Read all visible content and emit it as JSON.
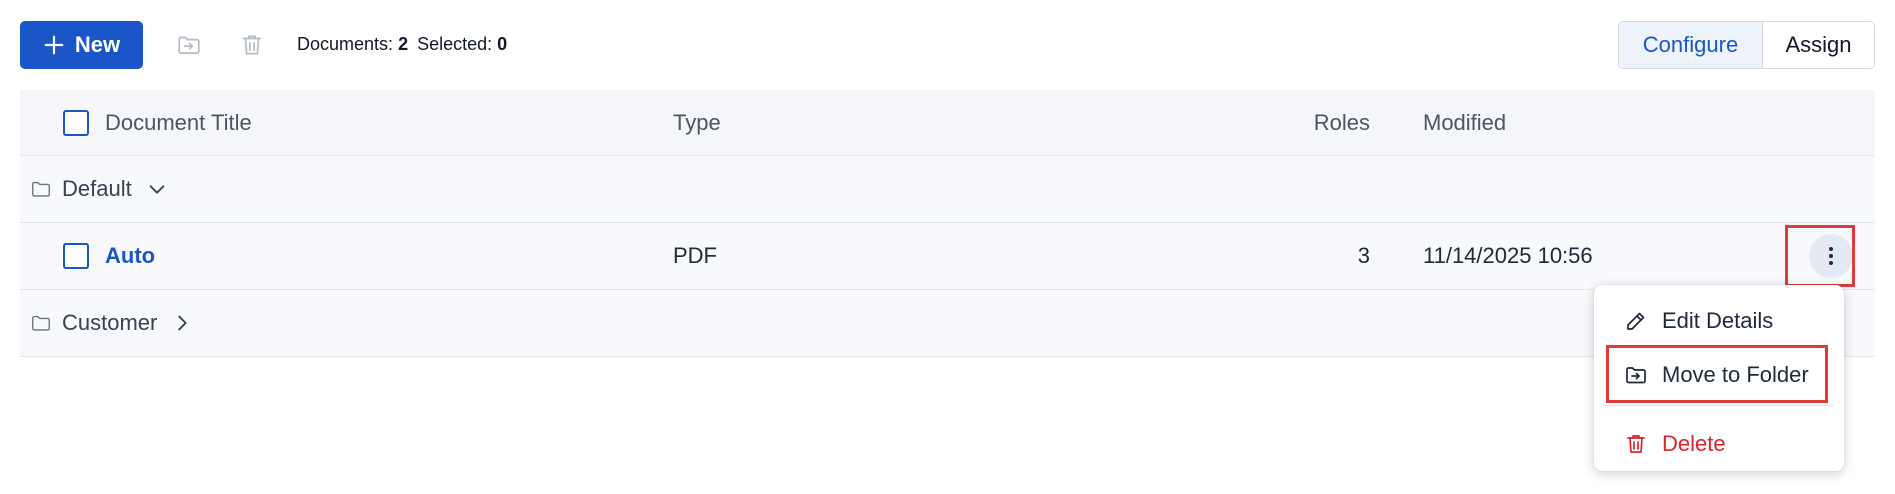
{
  "toolbar": {
    "new_label": "New",
    "documents_label": "Documents:",
    "documents_count": "2",
    "selected_label": "Selected:",
    "selected_count": "0",
    "configure_label": "Configure",
    "assign_label": "Assign",
    "icons": [
      "plus-icon",
      "move-to-folder-icon",
      "trash-icon"
    ]
  },
  "table": {
    "columns": [
      "Document Title",
      "Type",
      "Roles",
      "Modified"
    ],
    "folders": [
      {
        "name": "Default",
        "expanded": true,
        "documents": [
          {
            "title": "Auto",
            "type": "PDF",
            "roles": "3",
            "modified": "11/14/2025 10:56"
          }
        ]
      },
      {
        "name": "Customer",
        "expanded": false,
        "documents": []
      }
    ]
  },
  "context_menu": {
    "items": [
      {
        "label": "Edit Details",
        "icon": "pencil-icon"
      },
      {
        "label": "Move to Folder",
        "icon": "move-to-folder-icon"
      },
      {
        "label": "Delete",
        "icon": "trash-icon",
        "danger": true
      }
    ]
  },
  "colors": {
    "primary": "#1a56c7",
    "danger": "#d7262b",
    "highlight": "#e13a3a",
    "header_bg": "#f4f6fa"
  }
}
